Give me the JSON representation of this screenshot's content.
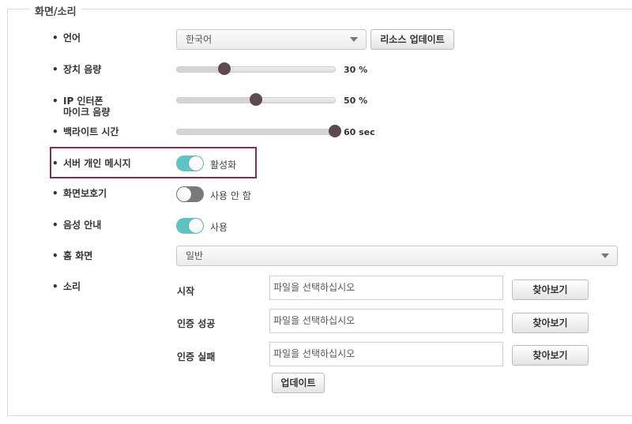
{
  "section": {
    "title": "화면/소리"
  },
  "settings": {
    "language": {
      "label": "언어",
      "value": "한국어",
      "button": "리소스 업데이트"
    },
    "volume": {
      "label": "장치 음량",
      "value": 30,
      "value_text": "30 %"
    },
    "mic_volume": {
      "label_line1": "IP 인터폰",
      "label_line2": "마이크 음량",
      "value": 50,
      "value_text": "50 %"
    },
    "backlight": {
      "label": "백라이트 시간",
      "value": 100,
      "value_text": "60 sec"
    },
    "server_message": {
      "label": "서버 개인 메시지",
      "state": "on",
      "state_text": "활성화"
    },
    "screensaver": {
      "label": "화면보호기",
      "state": "off",
      "state_text": "사용 안 함"
    },
    "voice_guide": {
      "label": "음성 안내",
      "state": "on",
      "state_text": "사용"
    },
    "home_screen": {
      "label": "홈 화면",
      "value": "일반"
    },
    "sound": {
      "label": "소리",
      "rows": [
        {
          "label": "시작",
          "placeholder": "파일을 선택하십시오",
          "button": "찾아보기"
        },
        {
          "label": "인증 성공",
          "placeholder": "파일을 선택하십시오",
          "button": "찾아보기"
        },
        {
          "label": "인증 실패",
          "placeholder": "파일을 선택하십시오",
          "button": "찾아보기"
        }
      ],
      "update_button": "업데이트"
    }
  },
  "colors": {
    "toggle_on": "#5ec3c3",
    "toggle_off": "#7a7a7a",
    "slider_thumb": "#5c4a50",
    "highlight_border": "#8b2a4e"
  }
}
